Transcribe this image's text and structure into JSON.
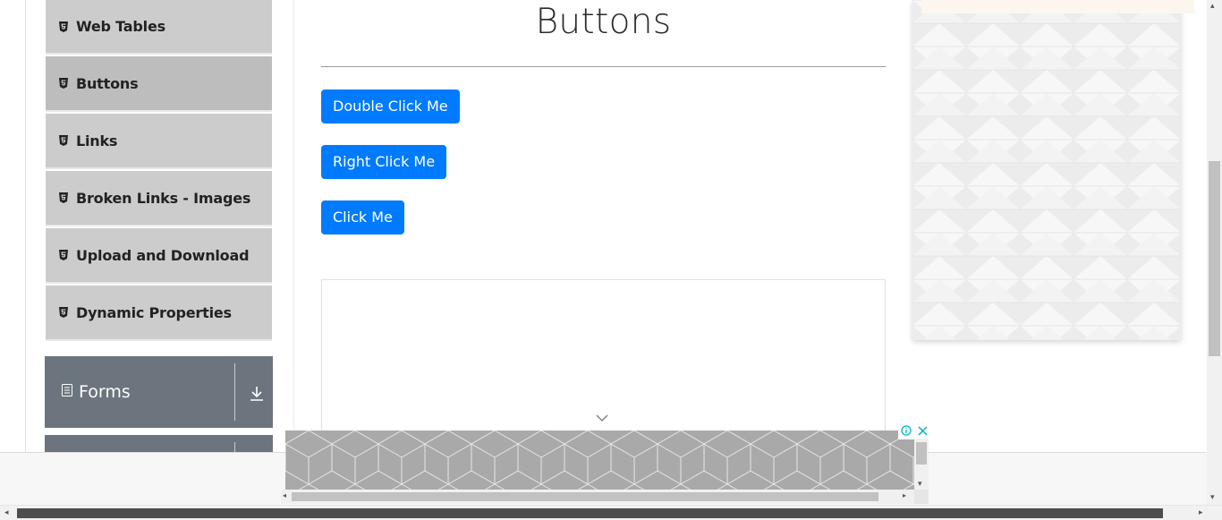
{
  "sidebar": {
    "items": [
      {
        "label": "Web Tables",
        "icon": "html5-icon",
        "active": false
      },
      {
        "label": "Buttons",
        "icon": "html5-icon",
        "active": true
      },
      {
        "label": "Links",
        "icon": "html5-icon",
        "active": false
      },
      {
        "label": "Broken Links - Images",
        "icon": "html5-icon",
        "active": false
      },
      {
        "label": "Upload and Download",
        "icon": "html5-icon",
        "active": false
      },
      {
        "label": "Dynamic Properties",
        "icon": "html5-icon",
        "active": false
      }
    ],
    "groups": [
      {
        "label": "Forms",
        "icon": "document-icon",
        "toggle_icon": "download-arrow-icon"
      },
      {
        "label": "",
        "icon": "",
        "toggle_icon": ""
      }
    ],
    "colors": {
      "item_bg": "#cccccc",
      "item_active_bg": "#bdbdbd",
      "group_bg": "#6c757d"
    }
  },
  "main": {
    "title": "Buttons",
    "buttons": [
      {
        "label": "Double Click Me"
      },
      {
        "label": "Right Click Me"
      },
      {
        "label": "Click Me"
      }
    ],
    "button_color": "#007bff"
  },
  "ad": {
    "info_icon": "info-icon",
    "close_icon": "close-icon",
    "accent": "#00aecd"
  }
}
